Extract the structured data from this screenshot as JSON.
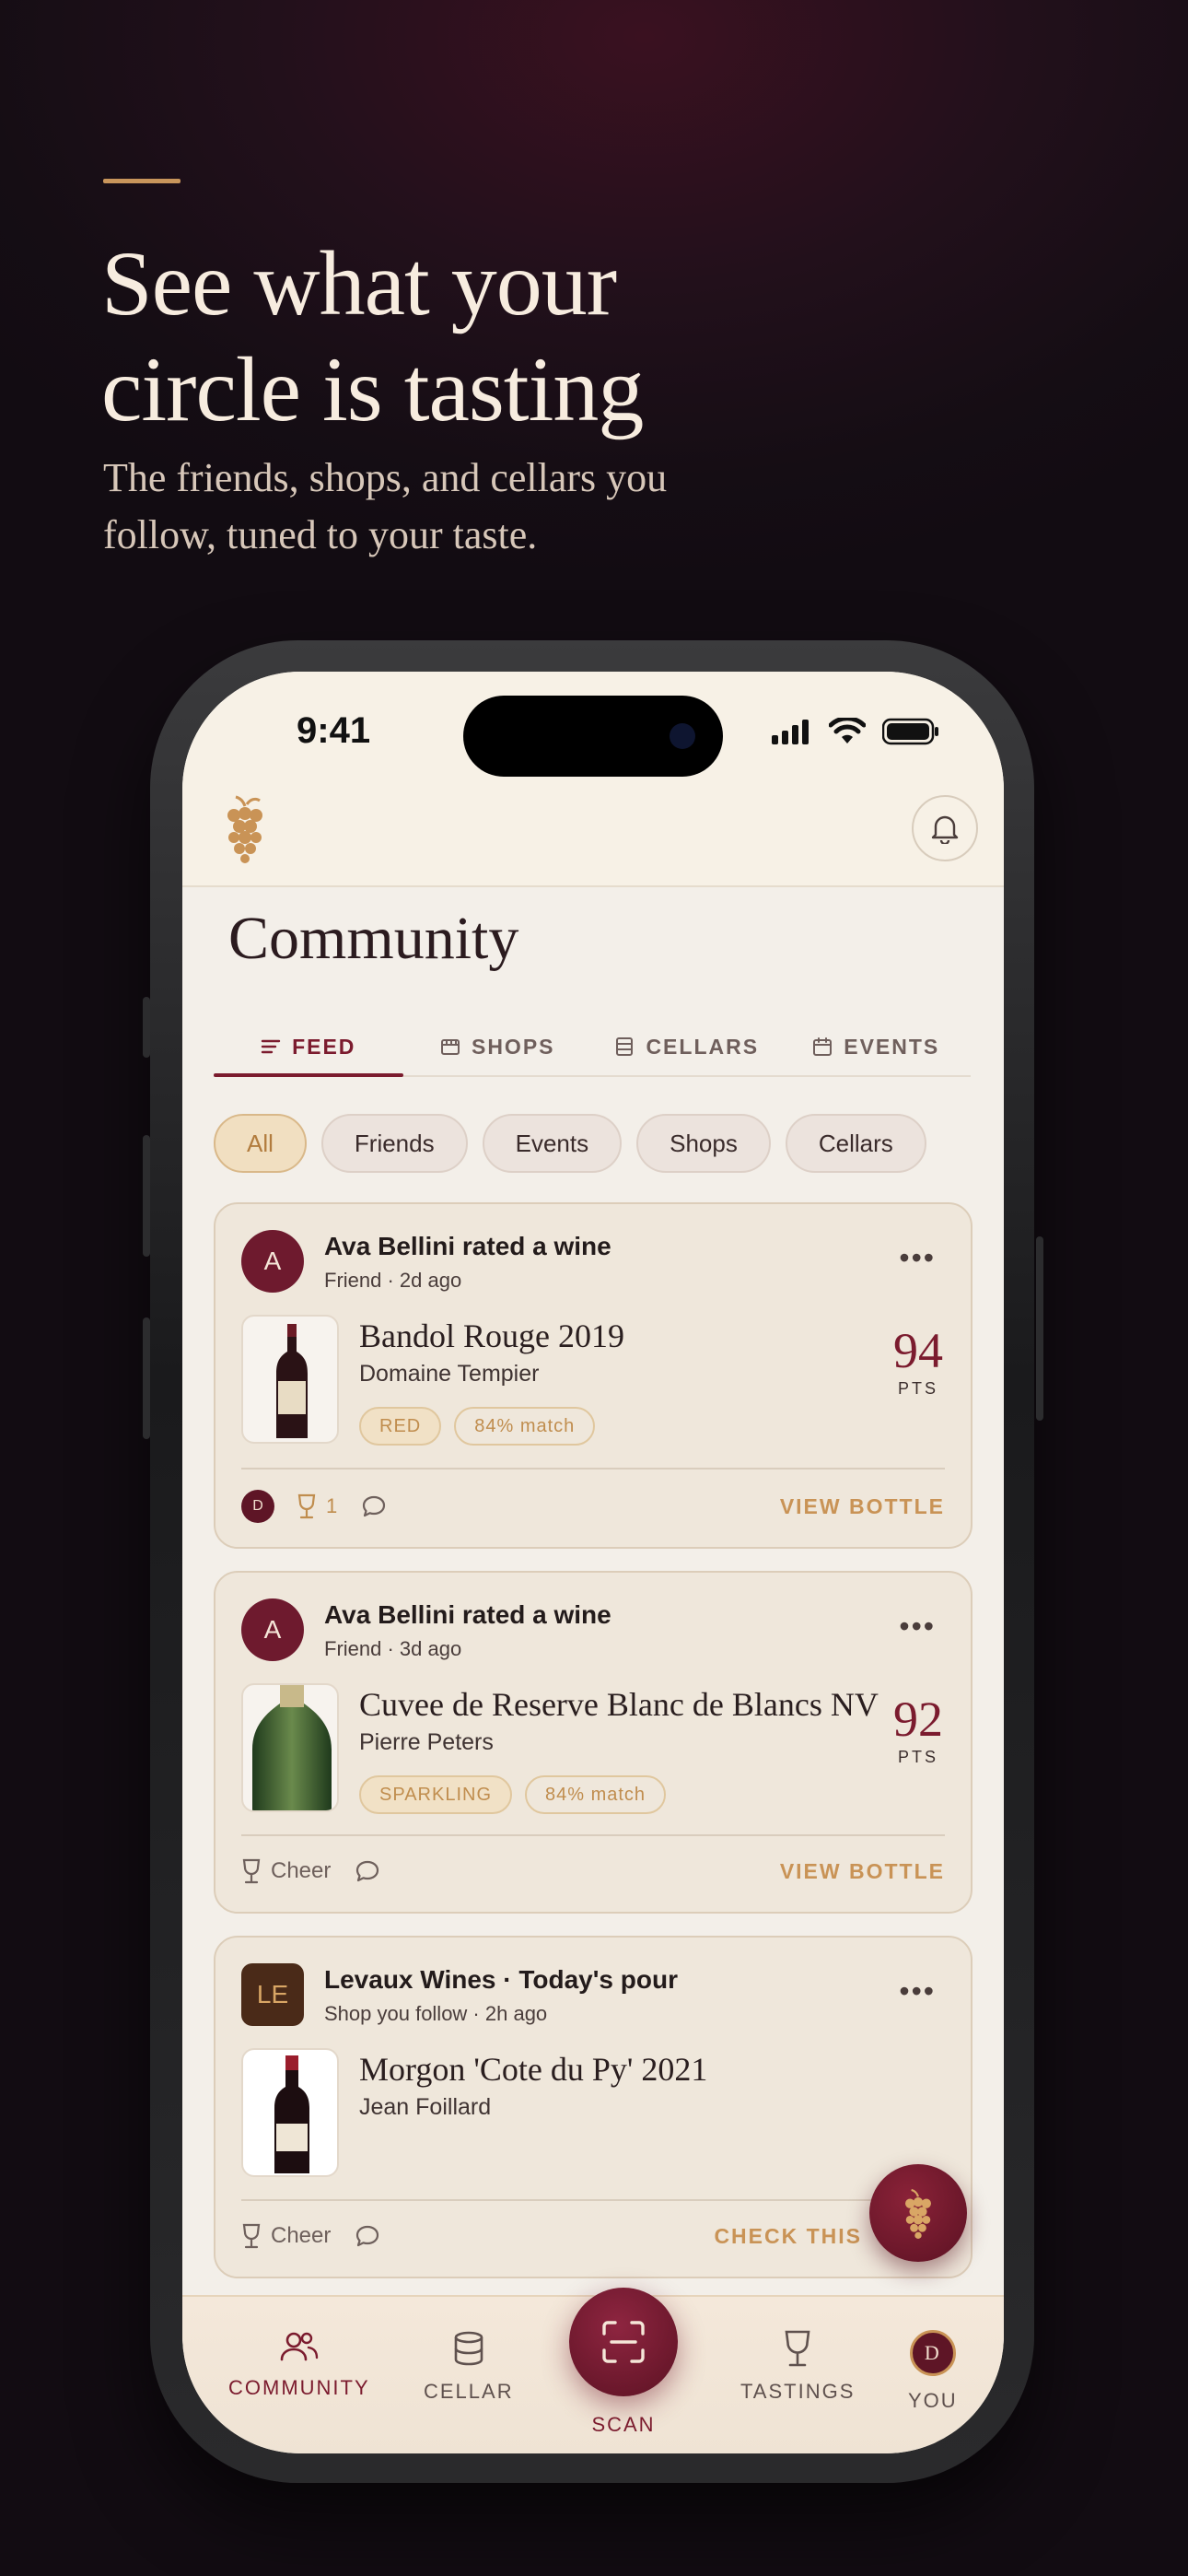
{
  "promo": {
    "headline_line1": "See what your",
    "headline_line2": "circle is tasting",
    "subhead": "The friends, shops, and cellars you follow, tuned to your taste."
  },
  "status_bar": {
    "time": "9:41"
  },
  "page": {
    "title": "Community"
  },
  "tabs": [
    {
      "label": "FEED",
      "icon": "list-icon"
    },
    {
      "label": "SHOPS",
      "icon": "storefront-icon"
    },
    {
      "label": "CELLARS",
      "icon": "cellar-icon"
    },
    {
      "label": "EVENTS",
      "icon": "calendar-icon"
    }
  ],
  "filters": [
    "All",
    "Friends",
    "Events",
    "Shops",
    "Cellars"
  ],
  "feed": [
    {
      "avatar": "A",
      "title": "Ava Bellini rated a wine",
      "subtitle": "Friend · 2d ago",
      "wine": "Bandol Rouge 2019",
      "producer": "Domaine Tempier",
      "tags": [
        "RED",
        "84% match"
      ],
      "score": "94",
      "score_label": "PTS",
      "reactor_avatar": "D",
      "cheer_count": "1",
      "action": "VIEW BOTTLE"
    },
    {
      "avatar": "A",
      "title": "Ava Bellini rated a wine",
      "subtitle": "Friend · 3d ago",
      "wine": "Cuvee de Reserve Blanc de Blancs NV",
      "producer": "Pierre Peters",
      "tags": [
        "SPARKLING",
        "84% match"
      ],
      "score": "92",
      "score_label": "PTS",
      "cheer_label": "Cheer",
      "action": "VIEW BOTTLE"
    },
    {
      "avatar": "LE",
      "title": "Levaux Wines · Today's pour",
      "subtitle": "Shop you follow · 2h ago",
      "wine": "Morgon 'Cote du Py' 2021",
      "producer": "Jean Foillard",
      "cheer_label": "Cheer",
      "action": "CHECK THIS"
    }
  ],
  "bottom_nav": {
    "community": "COMMUNITY",
    "cellar": "CELLAR",
    "scan": "SCAN",
    "tastings": "TASTINGS",
    "you": "YOU",
    "you_avatar": "D"
  },
  "colors": {
    "accent_wine": "#7b1b2e",
    "accent_gold": "#c99356",
    "background_dark": "#150d14",
    "screen_bg": "#f3efe9"
  }
}
